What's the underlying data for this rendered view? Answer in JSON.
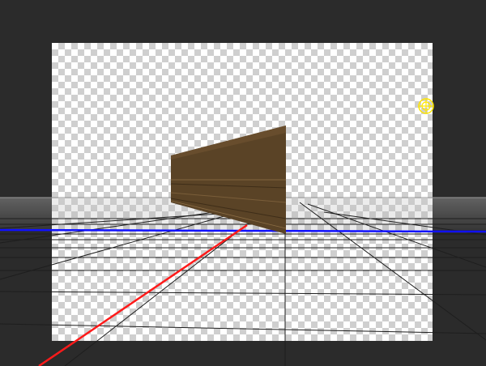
{
  "viewport": {
    "background_color": "#2b2b2b",
    "grid_color": "#1a1a1a",
    "x_axis_color": "#ff1a1a",
    "horizon_axis_color": "#1010ff"
  },
  "scene": {
    "object": {
      "name": "wooden-plank",
      "color": "#5a4326"
    },
    "light": {
      "icon": "light-gizmo-icon",
      "color": "#ffe600"
    }
  }
}
